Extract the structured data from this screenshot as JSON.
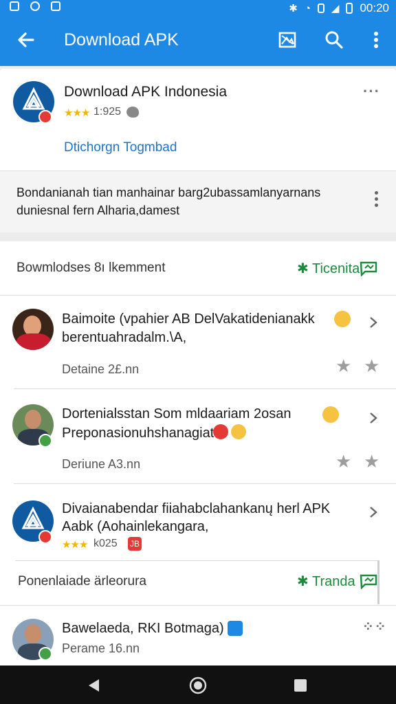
{
  "status_bar": {
    "time": "00:20"
  },
  "app_bar": {
    "title": "Download APK",
    "icons": [
      "back-arrow-icon",
      "image-icon",
      "search-icon",
      "more-vert-icon"
    ]
  },
  "header_card": {
    "name": "Download APK Indonesia",
    "rating": "1:925",
    "action_link": "Dtichorgn Togmbad",
    "description_line1": "Bondanianah tian manhainar barg2ubassamlanyarnans",
    "description_line2": "duniesnal fern Alharia,damest"
  },
  "section_header": {
    "title": "Bowmlodses 8ı lkemment",
    "action": "Ticenita"
  },
  "items": [
    {
      "title_line1": "Baimoite (vpahier AB DelVakatidenianakk",
      "title_line2": "berentuahradalm.\\A,",
      "meta": "Detaine 2£.nn"
    },
    {
      "title_line1": "Dortenialsstan Som mldaariam 2osan",
      "title_line2": "Preponasionuhshanagiat",
      "meta": "Deriune A3.nn"
    },
    {
      "title_line1": "Divaianabendar fiiahabclahankanų herl APK",
      "title_line2": "Aabk (Aohainlekangara,",
      "rating": "k025",
      "badge": "JB"
    }
  ],
  "footer_section": {
    "title": "Ponenlaiade ärleorura",
    "action": "Tranda"
  },
  "last_item": {
    "title": "Bawelaeda, RKI Botmaga)",
    "meta": "Perame 16.nn"
  }
}
